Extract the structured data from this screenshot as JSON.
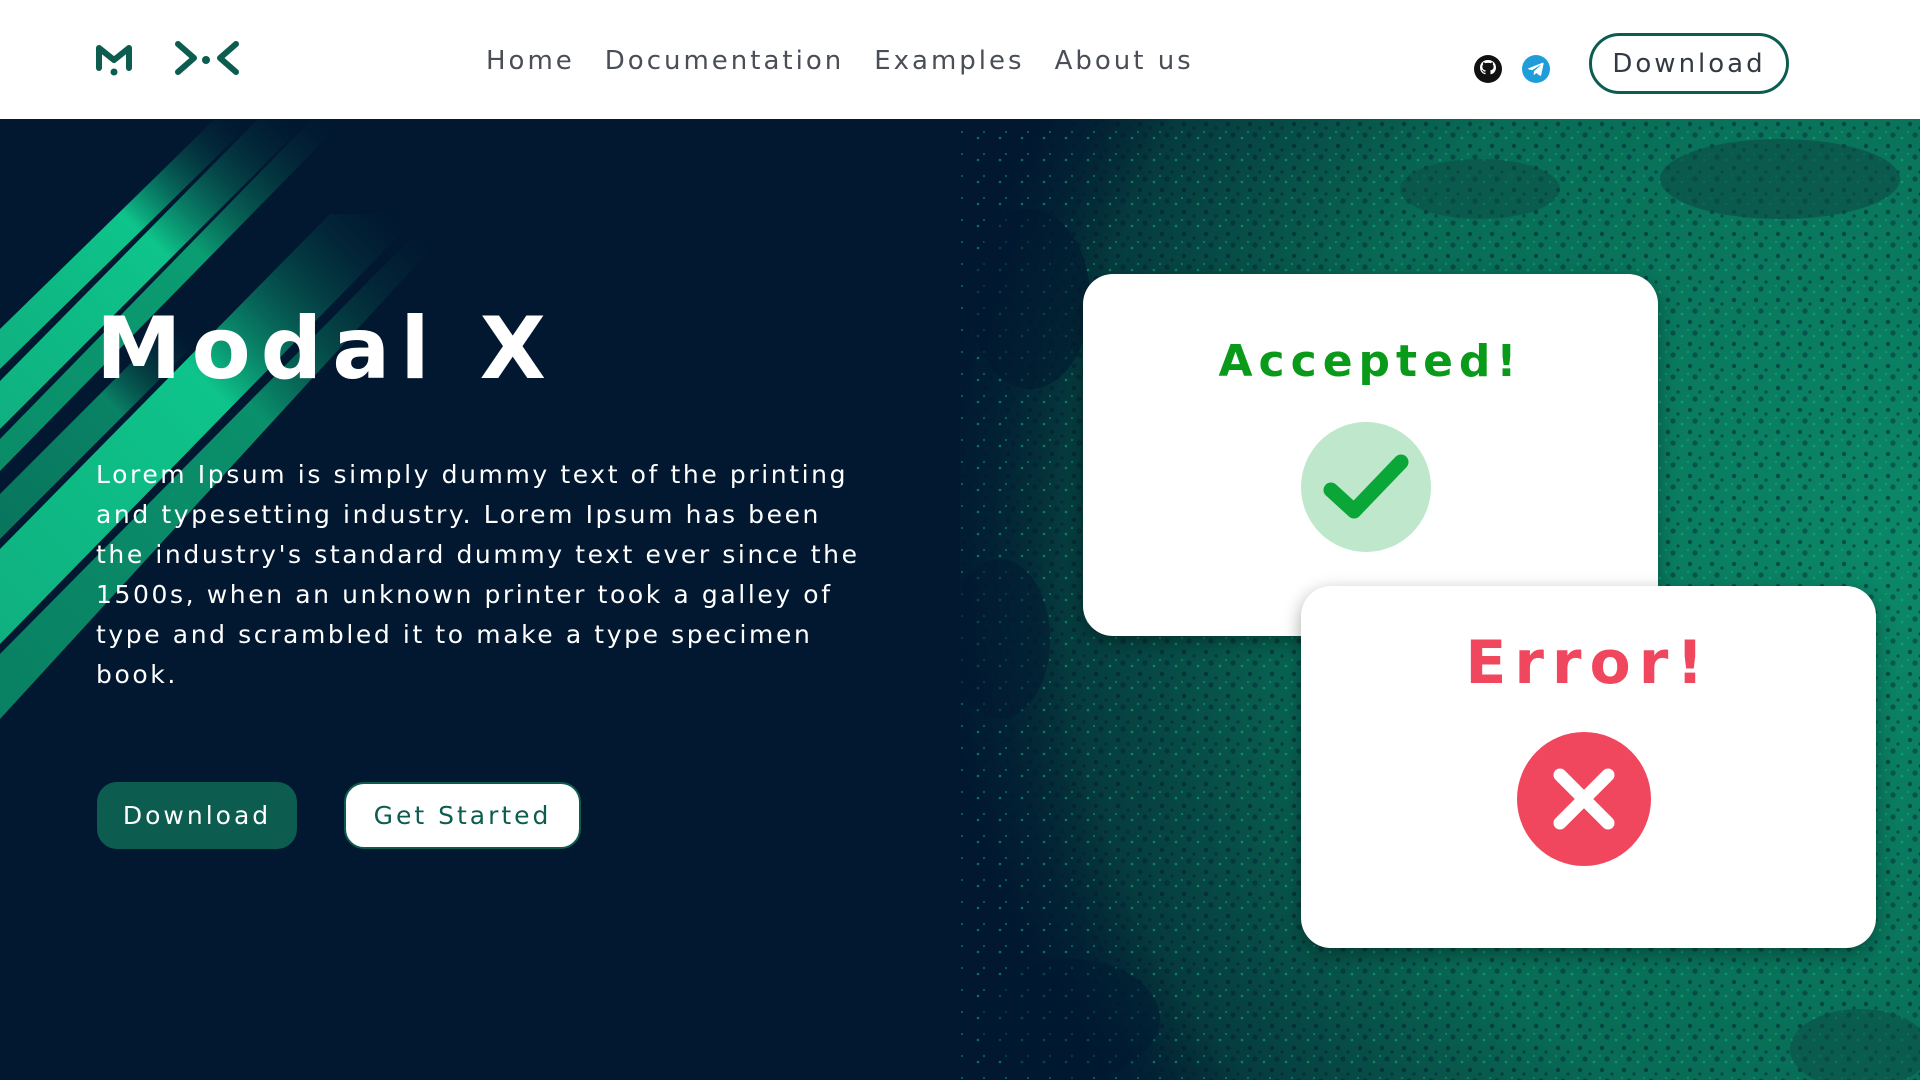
{
  "header": {
    "logo_alt": "MX",
    "nav": [
      {
        "label": "Home"
      },
      {
        "label": "Documentation"
      },
      {
        "label": "Examples"
      },
      {
        "label": "About us"
      }
    ],
    "social": [
      {
        "icon": "github-icon"
      },
      {
        "icon": "telegram-icon"
      }
    ],
    "download_label": "Download"
  },
  "hero": {
    "title": "Modal X",
    "description": "Lorem Ipsum is simply dummy text of the printing and typesetting industry. Lorem Ipsum has been the industry's standard dummy text ever since the 1500s, when an unknown printer took a galley of type and scrambled it to make a type specimen book.",
    "download_label": "Download",
    "get_started_label": "Get Started"
  },
  "cards": {
    "accepted": {
      "title": "Accepted!",
      "icon": "checkmark-icon"
    },
    "error": {
      "title": "Error!",
      "icon": "x-icon"
    }
  },
  "colors": {
    "brand": "#0c5c4f",
    "background": "#011830",
    "accent_green": "#0fb07f",
    "success": "#0a9a1a",
    "error": "#f0475e"
  }
}
